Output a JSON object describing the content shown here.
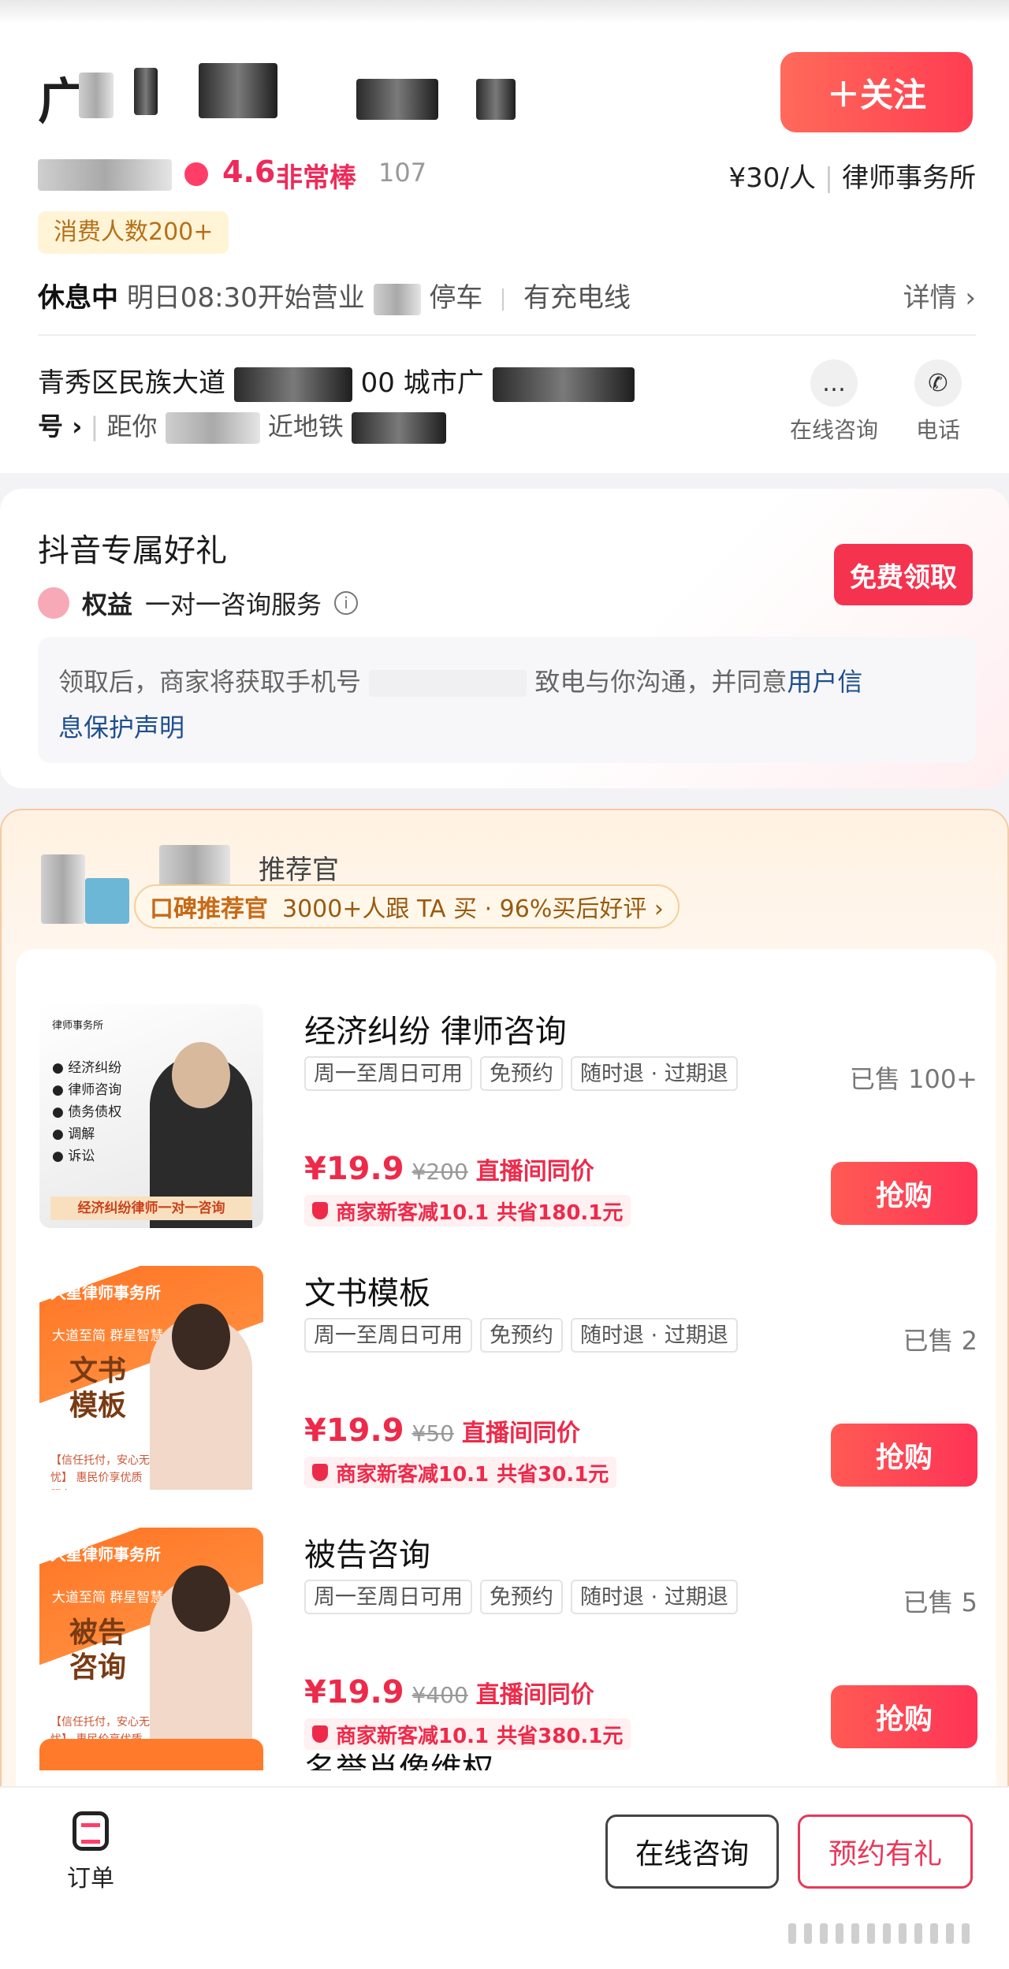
{
  "shop": {
    "title_visible": "广",
    "follow_label": "＋关注",
    "rating_score": "4.6",
    "rating_text": "非常棒",
    "rating_suffix": "107",
    "price_per_person": "¥30/人",
    "category": "律师事务所",
    "consumers_badge": "消费人数200+",
    "status": "休息中",
    "hours_note": "明日08:30开始营业",
    "parking": "停车",
    "charging": "有充电线",
    "details_label": "详情 ›",
    "address_line1": "青秀区民族大道",
    "address_line1_tail": "00 城市广",
    "address_line2_a": "号 ›",
    "address_line2_b": "距你",
    "address_line2_c": "近地铁",
    "contact_online": "在线咨询",
    "contact_phone": "电话"
  },
  "gift": {
    "title": "抖音专属好礼",
    "claim_label": "免费领取",
    "benefit_label": "权益",
    "benefit_value": "一对一咨询服务",
    "info_icon": "i",
    "notice_a": "领取后，商家将获取手机号",
    "notice_b": "致电与你沟通，并同意",
    "notice_link1": "用户信",
    "notice_link2": "息保护声明"
  },
  "recommend": {
    "subtitle": "推荐官",
    "pill_key": "口碑推荐官",
    "pill_value": "3000+人跟 TA 买 · 96%买后好评 ›"
  },
  "products": [
    {
      "title": "经济纠纷 律师咨询",
      "tags": [
        "周一至周日可用",
        "免预约",
        "随时退 · 过期退"
      ],
      "sold": "已售 100+",
      "price": "¥19.9",
      "original": "¥200",
      "same_price": "直播间同价",
      "discount": "商家新客减10.1",
      "saving": "共省180.1元",
      "buy_label": "抢购",
      "thumb_header": "律师事务所",
      "thumb_items": [
        "经济纠纷",
        "律师咨询",
        "债务债权",
        "调解",
        "诉讼"
      ],
      "thumb_footer": "经济纠纷律师一对一咨询"
    },
    {
      "title": "文书模板",
      "tags": [
        "周一至周日可用",
        "免预约",
        "随时退 · 过期退"
      ],
      "sold": "已售 2",
      "price": "¥19.9",
      "original": "¥50",
      "same_price": "直播间同价",
      "discount": "商家新客减10.1",
      "saving": "共省30.1元",
      "buy_label": "抢购",
      "thumb_logo": "大星律师事务所",
      "thumb_slogan": "大道至简 群星智慧",
      "thumb_big": "文书模板",
      "thumb_small": "【信任托付，安心无忧】 惠民价享优质服务"
    },
    {
      "title": "被告咨询",
      "tags": [
        "周一至周日可用",
        "免预约",
        "随时退 · 过期退"
      ],
      "sold": "已售 5",
      "price": "¥19.9",
      "original": "¥400",
      "same_price": "直播间同价",
      "discount": "商家新客减10.1",
      "saving": "共省380.1元",
      "buy_label": "抢购",
      "thumb_logo": "大星律师事务所",
      "thumb_slogan": "大道至简 群星智慧",
      "thumb_big": "被告咨询",
      "thumb_small": "【信任托付，安心无忧】 惠民价享优质服务"
    }
  ],
  "next_product_title": "名誉肖像维权",
  "bottom": {
    "orders_label": "订单",
    "consult_label": "在线咨询",
    "reserve_label": "预约有礼"
  }
}
